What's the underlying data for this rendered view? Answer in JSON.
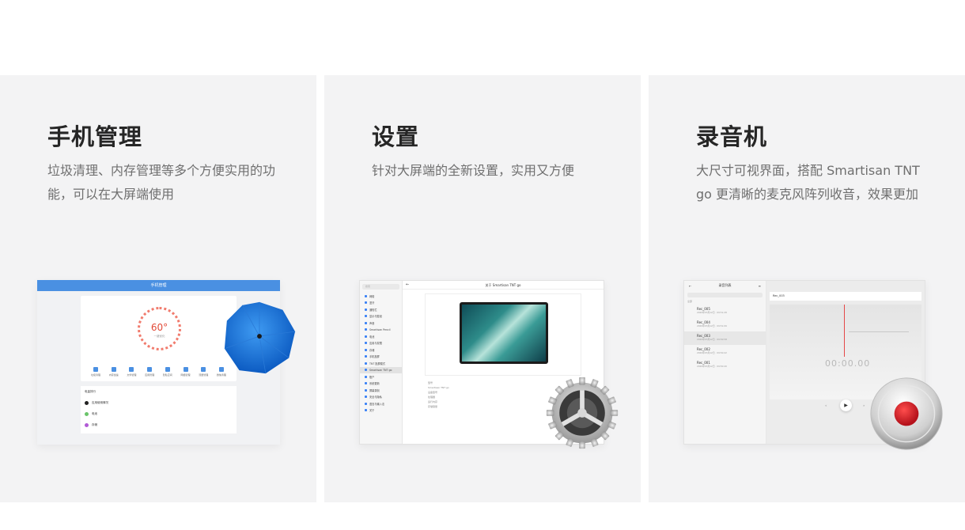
{
  "cards": [
    {
      "title": "手机管理",
      "desc": "垃圾清理、内存管理等多个方便实用的功能，可以在大屏端使用",
      "shot": {
        "window_title": "手机管理",
        "gauge_value": "60°",
        "gauge_label": "一键优化",
        "tools": [
          "垃圾清理",
          "内存加速",
          "文件管理",
          "应用管理",
          "隐私空间",
          "网络管理",
          "流量管理",
          "微信清理"
        ],
        "list_title": "电量排行",
        "rows": [
          "应用使用情况",
          "电池",
          "存储"
        ]
      }
    },
    {
      "title": "设置",
      "desc": "针对大屏端的全新设置，实用又方便",
      "shot": {
        "search_placeholder": "搜索",
        "header": "关于 Smartisan TNT go",
        "sidebar": [
          "网络",
          "蓝牙",
          "通知栏",
          "显示与壁纸",
          "声音",
          "Smartisan Pencil",
          "电池",
          "应用与权限",
          "存储",
          "手机投屏",
          "TNT 投屏模式",
          "Smartisan TNT go",
          "账户",
          "系统更新",
          "屏幕录制",
          "安全与隐私",
          "语言与输入法",
          "关于"
        ],
        "selected_index": 11,
        "info": [
          "型号",
          "Smartisan TNT go",
          "设备型号",
          "处理器",
          "运行内存",
          "存储容量"
        ]
      }
    },
    {
      "title": "录音机",
      "desc": "大尺寸可视界面，搭配 Smartisan TNT go 更清晰的麦克风阵列收音，效果更加",
      "shot": {
        "list_title": "录音列表",
        "section_label": "全部",
        "current_name": "Rec_003",
        "timer": "00:00.00",
        "items": [
          {
            "name": "Rec_005",
            "date": "2020年03月12日 · 09:51:28"
          },
          {
            "name": "Rec_004",
            "date": "2020年03月12日 · 09:51:06"
          },
          {
            "name": "Rec_003",
            "date": "2020年03月12日 · 09:50:58"
          },
          {
            "name": "Rec_002",
            "date": "2020年03月12日 · 09:50:42"
          },
          {
            "name": "Rec_001",
            "date": "2020年03月12日 · 09:50:40"
          }
        ],
        "selected_index": 2
      }
    }
  ],
  "colors": {
    "accent_blue": "#4a90e2",
    "record_red": "#d9202a",
    "card_bg": "#f3f3f4"
  }
}
